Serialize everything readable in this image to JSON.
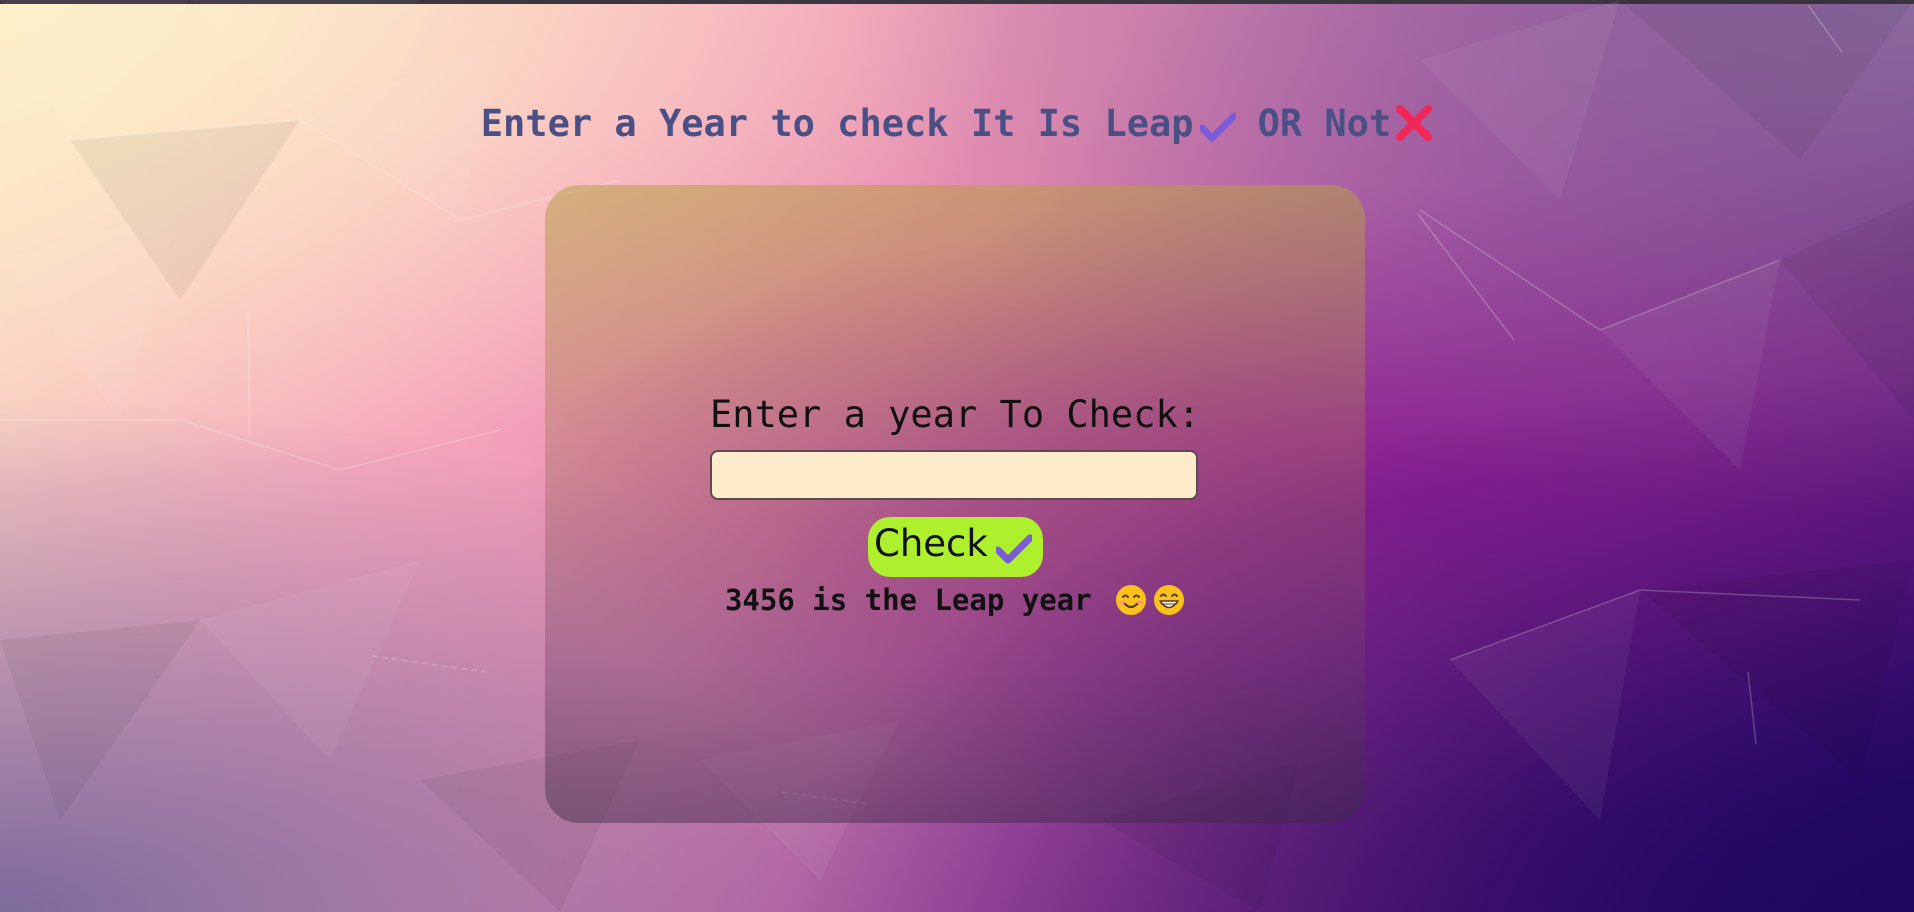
{
  "header": {
    "title_before": "Enter a Year to check It Is Leap",
    "title_middle": "OR Not",
    "check_icon": "check-mark-icon",
    "cross_icon": "cross-mark-icon"
  },
  "form": {
    "prompt": "Enter a year To Check:",
    "input_value": "",
    "input_placeholder": "",
    "button_label": "Check",
    "button_icon": "check-mark-icon"
  },
  "result": {
    "text": "3456 is the Leap year",
    "emojis": [
      "smiling-face-icon",
      "grinning-face-icon"
    ]
  },
  "colors": {
    "headline": "#4a4f84",
    "button": "#aef02d",
    "check": "#7b5bd6",
    "cross": "#f0285a",
    "input_bg": "#fdebcb"
  }
}
